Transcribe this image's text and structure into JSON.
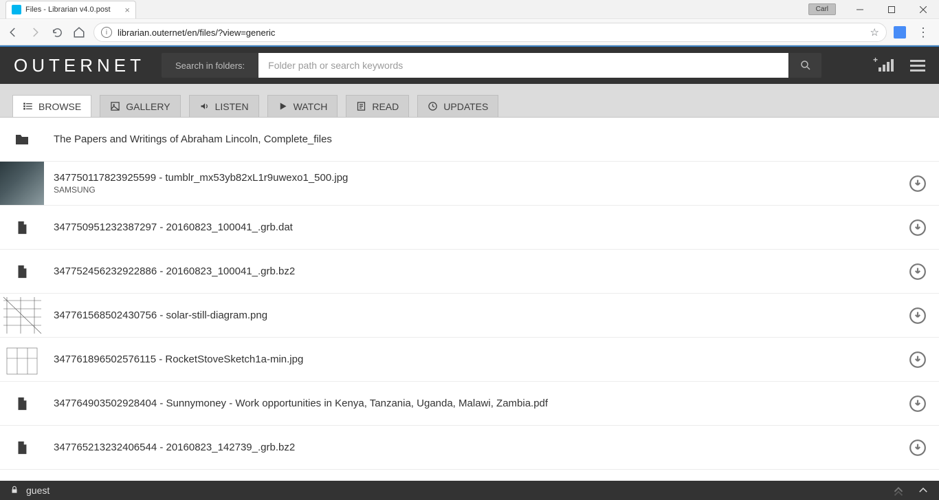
{
  "browser": {
    "tab_title": "Files - Librarian v4.0.post",
    "user_badge": "Carl",
    "url_display": "librarian.outernet/en/files/?view=generic"
  },
  "header": {
    "brand": "OUTERNET",
    "search_label": "Search in folders:",
    "search_placeholder": "Folder path or search keywords"
  },
  "tabs": {
    "browse": "BROWSE",
    "gallery": "GALLERY",
    "listen": "LISTEN",
    "watch": "WATCH",
    "read": "READ",
    "updates": "UPDATES"
  },
  "files": [
    {
      "type": "folder",
      "title": "The Papers and Writings of Abraham Lincoln, Complete_files",
      "sub": "",
      "download": false
    },
    {
      "type": "image",
      "title": "347750117823925599 - tumblr_mx53yb82xL1r9uwexo1_500.jpg",
      "sub": "SAMSUNG",
      "download": true,
      "thumb_variant": "photo"
    },
    {
      "type": "file",
      "title": "347750951232387297 - 20160823_100041_.grb.dat",
      "sub": "",
      "download": true
    },
    {
      "type": "file",
      "title": "347752456232922886 - 20160823_100041_.grb.bz2",
      "sub": "",
      "download": true
    },
    {
      "type": "image",
      "title": "347761568502430756 - solar-still-diagram.png",
      "sub": "",
      "download": true,
      "thumb_variant": "diagram1"
    },
    {
      "type": "image",
      "title": "347761896502576115 - RocketStoveSketch1a-min.jpg",
      "sub": "",
      "download": true,
      "thumb_variant": "diagram2"
    },
    {
      "type": "file",
      "title": "347764903502928404 - Sunnymoney - Work opportunities in Kenya, Tanzania, Uganda, Malawi, Zambia.pdf",
      "sub": "",
      "download": true
    },
    {
      "type": "file",
      "title": "347765213232406544 - 20160823_142739_.grb.bz2",
      "sub": "",
      "download": true
    }
  ],
  "footer": {
    "user": "guest"
  }
}
